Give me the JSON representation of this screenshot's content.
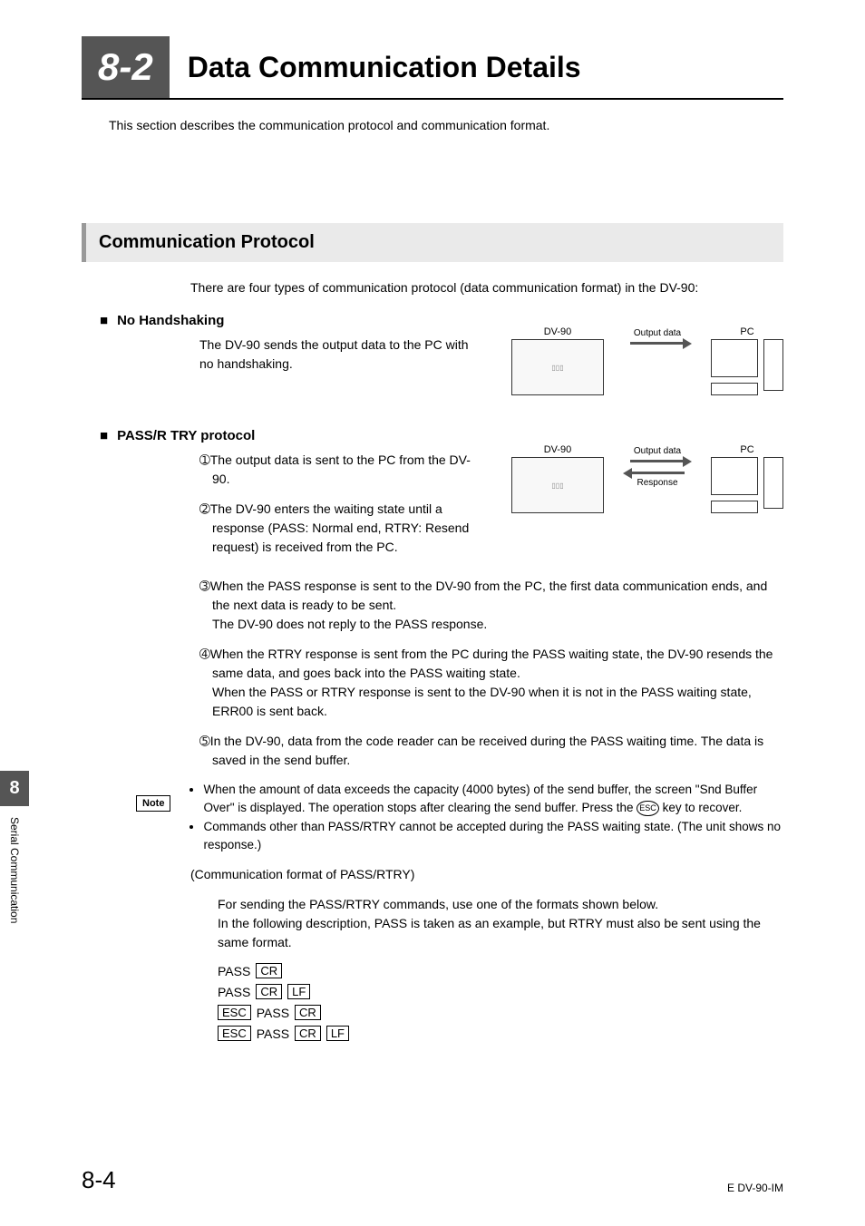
{
  "chapter": {
    "number": "8-2",
    "title": "Data Communication Details"
  },
  "intro": "This section describes the communication protocol and communication format.",
  "section": {
    "title": "Communication Protocol",
    "intro": "There are four types of communication protocol (data communication format) in the DV-90:"
  },
  "sub1": {
    "heading": "No Handshaking",
    "text": "The DV-90 sends the output data to the PC with no handshaking."
  },
  "sub2": {
    "heading": "PASS/R TRY protocol",
    "items": [
      "➀The output data is sent to the PC from the DV-90.",
      "➁The DV-90 enters the waiting state until a response (PASS: Normal end, RTRY: Resend request) is received from the PC.",
      "➂When the PASS response is sent to the DV-90 from the PC, the first data communication ends, and the next data is ready to be sent.\nThe DV-90 does not reply to the PASS response.",
      "➃When the RTRY response is sent from the PC during the PASS waiting state, the DV-90 resends the same data, and goes back into the PASS waiting state.\nWhen the PASS or RTRY response is sent to the DV-90 when it is not in the PASS waiting state, ERR00 is sent back.",
      "➄In the DV-90, data from the code reader can be received during the PASS waiting time. The data is saved in the send buffer."
    ]
  },
  "note": {
    "label": "Note",
    "bullets": [
      "When the amount of data exceeds the capacity (4000 bytes) of the send buffer, the screen \"Snd Buffer Over\" is displayed. The operation stops after clearing the send buffer. Press the ESC key to recover.",
      "Commands other than PASS/RTRY cannot be accepted during the PASS waiting state. (The unit shows no response.)"
    ],
    "esc_label": "ESC"
  },
  "comm_format": {
    "heading": "(Communication format of PASS/RTRY)",
    "text": "For sending the PASS/RTRY commands, use one of the formats shown below.\nIn the following description, PASS is taken as an example, but RTRY must also be sent using the same format.",
    "rows": [
      [
        "PASS",
        "CR"
      ],
      [
        "PASS",
        "CR",
        "LF"
      ],
      [
        "ESC",
        "PASS",
        "CR"
      ],
      [
        "ESC",
        "PASS",
        "CR",
        "LF"
      ]
    ]
  },
  "diagram": {
    "dv90": "DV-90",
    "pc": "PC",
    "output": "Output data",
    "response": "Response"
  },
  "side": {
    "num": "8",
    "label": "Serial Communication"
  },
  "footer": {
    "page": "8-4",
    "doc": "E DV-90-IM"
  }
}
